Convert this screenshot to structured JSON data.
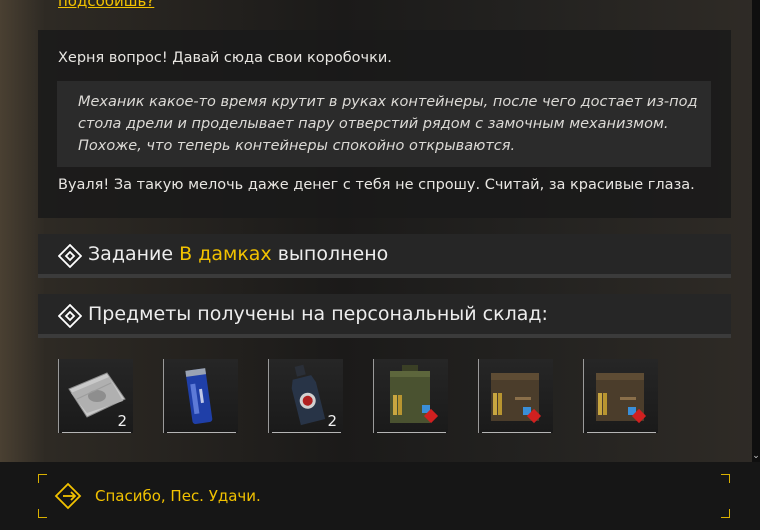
{
  "dialog": {
    "previous_player_line": "подсобишь?",
    "npc_line_1": "Херня вопрос! Давай сюда свои коробочки.",
    "action_text": "Механик какое-то время крутит в руках контейнеры, после чего достает из-под стола дрели и проделывает пару отверстий рядом с замочным механизмом. Похоже, что теперь контейнеры спокойно открываются.",
    "npc_line_2": "Вуаля! За такую мелочь даже денег с тебя не спрошу. Считай, за красивые глаза."
  },
  "quest_banner": {
    "prefix": "Задание",
    "quest_name": "В дамках",
    "suffix": "выполнено",
    "icon": "diamond-quest-icon"
  },
  "items_banner": {
    "text": "Предметы получены на персональный склад:",
    "icon": "diamond-quest-icon"
  },
  "items": [
    {
      "icon": "money-bundle-icon",
      "count": "2"
    },
    {
      "icon": "energy-drink-can-icon",
      "count": ""
    },
    {
      "icon": "medical-bottle-icon",
      "count": "2"
    },
    {
      "icon": "green-ammo-box-icon",
      "count": ""
    },
    {
      "icon": "brown-ammo-box-icon",
      "count": ""
    },
    {
      "icon": "brown-ammo-box-icon",
      "count": ""
    }
  ],
  "reply": {
    "text": "Спасибо, Пес. Удачи.",
    "icon": "exit-reply-icon"
  },
  "scroll": {
    "down_glyph": "⌄"
  },
  "colors": {
    "accent": "#f2c200",
    "panel": "#1a1a1a",
    "text": "#e8e6e2"
  }
}
